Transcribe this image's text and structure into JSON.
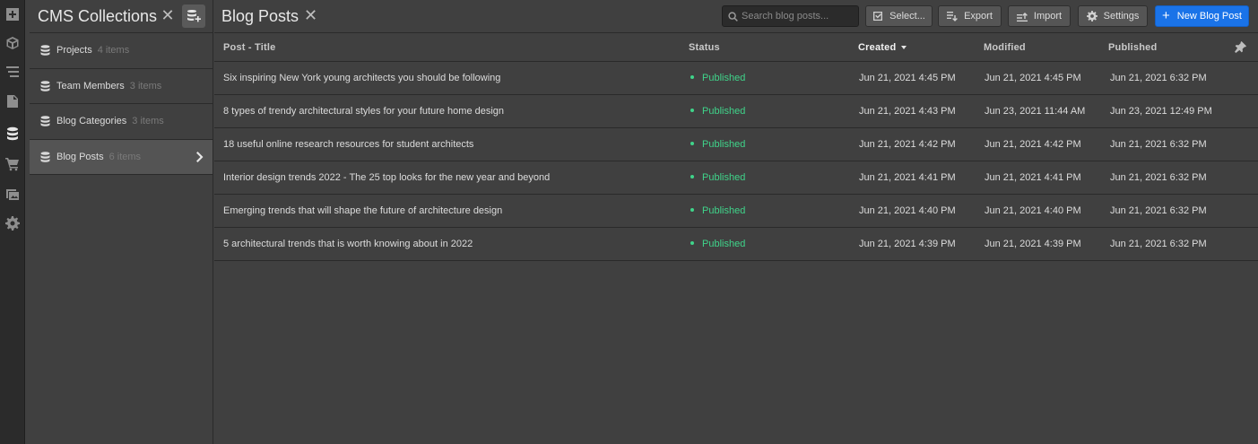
{
  "rail": {
    "icons": [
      "add-icon",
      "box-icon",
      "navigator-icon",
      "pages-icon",
      "cms-icon",
      "ecommerce-icon",
      "assets-icon",
      "settings-icon"
    ],
    "active": "cms-icon"
  },
  "collections": {
    "title": "CMS Collections",
    "close": "✕",
    "items": [
      {
        "name": "Projects",
        "count": "4 items"
      },
      {
        "name": "Team Members",
        "count": "3 items"
      },
      {
        "name": "Blog Categories",
        "count": "3 items"
      },
      {
        "name": "Blog Posts",
        "count": "6 items"
      }
    ],
    "selected_index": 3
  },
  "main": {
    "title": "Blog Posts",
    "close": "✕"
  },
  "toolbar": {
    "search_placeholder": "Search blog posts...",
    "select_label": "Select...",
    "export_label": "Export",
    "import_label": "Import",
    "settings_label": "Settings",
    "new_label": "New Blog Post",
    "new_plus": "+"
  },
  "table": {
    "columns": [
      "Post - Title",
      "Status",
      "Created",
      "Modified",
      "Published"
    ],
    "sorted_column": "Created",
    "rows": [
      {
        "title": "Six inspiring New York young architects you should be following",
        "status": "Published",
        "created": "Jun 21, 2021 4:45 PM",
        "modified": "Jun 21, 2021 4:45 PM",
        "published": "Jun 21, 2021 6:32 PM"
      },
      {
        "title": "8 types of trendy architectural styles for your future home design",
        "status": "Published",
        "created": "Jun 21, 2021 4:43 PM",
        "modified": "Jun 23, 2021 11:44 AM",
        "published": "Jun 23, 2021 12:49 PM"
      },
      {
        "title": "18 useful online research resources for student architects",
        "status": "Published",
        "created": "Jun 21, 2021 4:42 PM",
        "modified": "Jun 21, 2021 4:42 PM",
        "published": "Jun 21, 2021 6:32 PM"
      },
      {
        "title": "Interior design trends 2022 - The 25 top looks for the new year and beyond",
        "status": "Published",
        "created": "Jun 21, 2021 4:41 PM",
        "modified": "Jun 21, 2021 4:41 PM",
        "published": "Jun 21, 2021 6:32 PM"
      },
      {
        "title": "Emerging trends that will shape the future of architecture design",
        "status": "Published",
        "created": "Jun 21, 2021 4:40 PM",
        "modified": "Jun 21, 2021 4:40 PM",
        "published": "Jun 21, 2021 6:32 PM"
      },
      {
        "title": "5 architectural trends that is worth knowing about in 2022",
        "status": "Published",
        "created": "Jun 21, 2021 4:39 PM",
        "modified": "Jun 21, 2021 4:39 PM",
        "published": "Jun 21, 2021 6:32 PM"
      }
    ]
  },
  "colors": {
    "accent": "#1a73e8",
    "status_published": "#3fd48a",
    "background": "#404040"
  }
}
